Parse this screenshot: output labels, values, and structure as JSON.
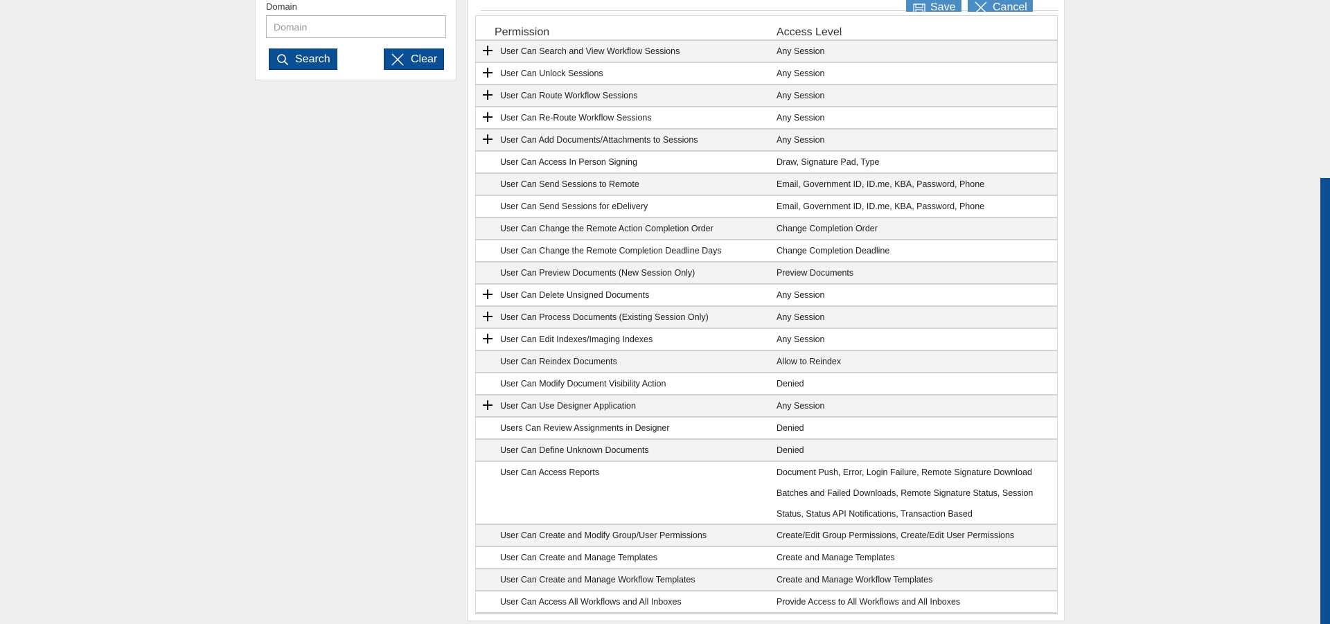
{
  "search_panel": {
    "domain_label": "Domain",
    "domain_value": "",
    "domain_placeholder": "Domain",
    "search_label": "Search",
    "clear_label": "Clear"
  },
  "toolbar": {
    "save_label": "Save",
    "cancel_label": "Cancel"
  },
  "table": {
    "headers": {
      "permission": "Permission",
      "access_level": "Access Level"
    },
    "rows": [
      {
        "permission": "User Can Search and View Workflow Sessions",
        "access": "Any Session",
        "expandable": true
      },
      {
        "permission": "User Can Unlock Sessions",
        "access": "Any Session",
        "expandable": true
      },
      {
        "permission": "User Can Route Workflow Sessions",
        "access": "Any Session",
        "expandable": true
      },
      {
        "permission": "User Can Re-Route Workflow Sessions",
        "access": "Any Session",
        "expandable": true
      },
      {
        "permission": "User Can Add Documents/Attachments to Sessions",
        "access": "Any Session",
        "expandable": true
      },
      {
        "permission": "User Can Access In Person Signing",
        "access": "Draw, Signature Pad, Type",
        "expandable": false
      },
      {
        "permission": "User Can Send Sessions to Remote",
        "access": "Email, Government ID, ID.me, KBA, Password, Phone",
        "expandable": false
      },
      {
        "permission": "User Can Send Sessions for eDelivery",
        "access": "Email, Government ID, ID.me, KBA, Password, Phone",
        "expandable": false
      },
      {
        "permission": "User Can Change the Remote Action Completion Order",
        "access": "Change Completion Order",
        "expandable": false
      },
      {
        "permission": "User Can Change the Remote Completion Deadline Days",
        "access": "Change Completion Deadline",
        "expandable": false
      },
      {
        "permission": "User Can Preview Documents (New Session Only)",
        "access": "Preview Documents",
        "expandable": false
      },
      {
        "permission": "User Can Delete Unsigned Documents",
        "access": "Any Session",
        "expandable": true
      },
      {
        "permission": "User Can Process Documents (Existing Session Only)",
        "access": "Any Session",
        "expandable": true
      },
      {
        "permission": "User Can Edit Indexes/Imaging Indexes",
        "access": "Any Session",
        "expandable": true
      },
      {
        "permission": "User Can Reindex Documents",
        "access": "Allow to Reindex",
        "expandable": false
      },
      {
        "permission": "User Can Modify Document Visibility Action",
        "access": "Denied",
        "expandable": false
      },
      {
        "permission": "User Can Use Designer Application",
        "access": "Any Session",
        "expandable": true
      },
      {
        "permission": "Users Can Review Assignments in Designer",
        "access": "Denied",
        "expandable": false
      },
      {
        "permission": "User Can Define Unknown Documents",
        "access": "Denied",
        "expandable": false
      },
      {
        "permission": "User Can Access Reports",
        "access": "Document Push, Error, Login Failure, Remote Signature Download Batches and Failed Downloads, Remote Signature Status, Session Status, Status API Notifications, Transaction Based",
        "expandable": false,
        "tall": true
      },
      {
        "permission": "User Can Create and Modify Group/User Permissions",
        "access": "Create/Edit Group Permissions, Create/Edit User Permissions",
        "expandable": false
      },
      {
        "permission": "User Can Create and Manage Templates",
        "access": "Create and Manage Templates",
        "expandable": false
      },
      {
        "permission": "User Can Create and Manage Workflow Templates",
        "access": "Create and Manage Workflow Templates",
        "expandable": false
      },
      {
        "permission": "User Can Access All Workflows and All Inboxes",
        "access": "Provide Access to All Workflows and All Inboxes",
        "expandable": false
      }
    ]
  },
  "icons": {
    "search": "search-icon",
    "clear": "close-icon",
    "save": "floppy-disk-icon",
    "cancel": "close-icon",
    "expand": "plus-icon"
  },
  "colors": {
    "primary_button": "#0a4f94",
    "toolbar_button": "#4a8cc4",
    "row_alt": "#f3f3f3",
    "scroll_accent": "#0d4f97"
  }
}
